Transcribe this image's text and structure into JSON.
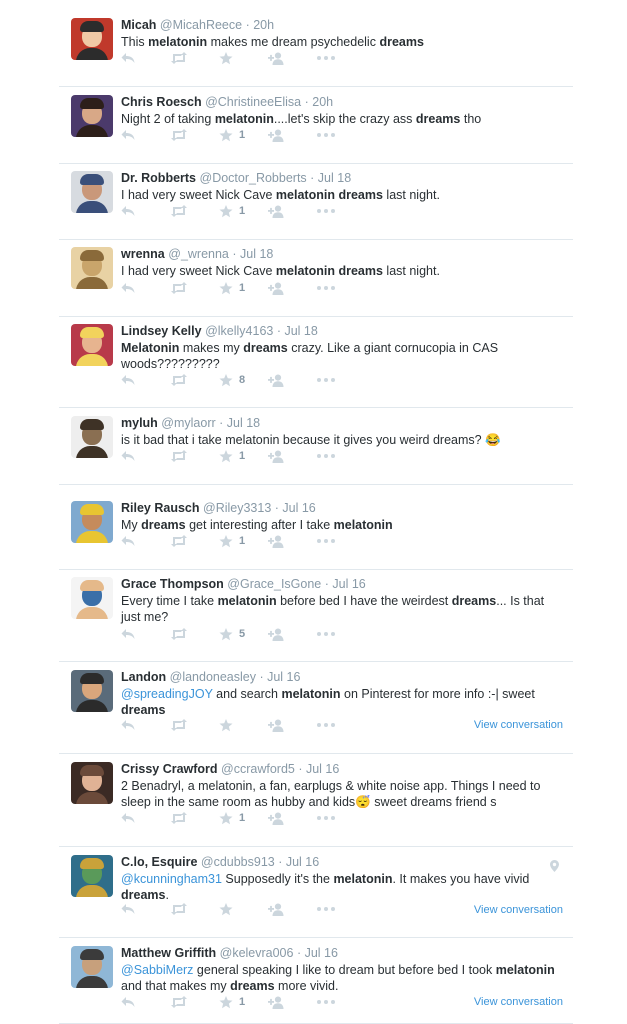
{
  "tweets": [
    {
      "name": "Micah",
      "handle": "@MicahReece",
      "time": "20h",
      "segments": [
        {
          "t": "This "
        },
        {
          "t": "melatonin",
          "b": true
        },
        {
          "t": " makes me dream psychedelic "
        },
        {
          "t": "dreams",
          "b": true
        }
      ],
      "favorites": "",
      "view_conversation": "",
      "avatar": [
        "#c0392b",
        "#f0c9a6",
        "#2c2c2c"
      ]
    },
    {
      "name": "Chris Roesch",
      "handle": "@ChristineeElisa",
      "time": "20h",
      "segments": [
        {
          "t": "Night 2 of taking "
        },
        {
          "t": "melatonin",
          "b": true
        },
        {
          "t": "....let's skip the crazy ass "
        },
        {
          "t": "dreams",
          "b": true
        },
        {
          "t": " tho"
        }
      ],
      "favorites": "1",
      "view_conversation": "",
      "avatar": [
        "#4b3a6b",
        "#d8a887",
        "#2d1f1a"
      ]
    },
    {
      "name": "Dr. Robberts",
      "handle": "@Doctor_Robberts",
      "time": "Jul 18",
      "segments": [
        {
          "t": "I had very sweet Nick Cave "
        },
        {
          "t": "melatonin",
          "b": true
        },
        {
          "t": " "
        },
        {
          "t": "dreams",
          "b": true
        },
        {
          "t": " last night."
        }
      ],
      "favorites": "1",
      "view_conversation": "",
      "avatar": [
        "#d7dbe0",
        "#c9987a",
        "#3a4f7a"
      ]
    },
    {
      "name": "wrenna",
      "handle": "@_wrenna",
      "time": "Jul 18",
      "segments": [
        {
          "t": "I had very sweet Nick Cave "
        },
        {
          "t": "melatonin",
          "b": true
        },
        {
          "t": " "
        },
        {
          "t": "dreams",
          "b": true
        },
        {
          "t": " last night."
        }
      ],
      "favorites": "1",
      "view_conversation": "",
      "avatar": [
        "#e8d2a4",
        "#c9a56b",
        "#8a6a3a"
      ]
    },
    {
      "name": "Lindsey Kelly",
      "handle": "@lkelly4163",
      "time": "Jul 18",
      "segments": [
        {
          "t": "Melatonin",
          "b": true
        },
        {
          "t": " makes my "
        },
        {
          "t": "dreams",
          "b": true
        },
        {
          "t": " crazy. Like a giant cornucopia in CAS woods?????????"
        }
      ],
      "favorites": "8",
      "view_conversation": "",
      "avatar": [
        "#b83a4a",
        "#e7b48f",
        "#f2d35c"
      ]
    },
    {
      "name": "myluh",
      "handle": "@mylaorr",
      "time": "Jul 18",
      "segments": [
        {
          "t": "is it bad that i take melatonin because it gives you weird dreams? 😂"
        }
      ],
      "favorites": "1",
      "view_conversation": "",
      "avatar": [
        "#eeeeee",
        "#8a6f52",
        "#3e3226"
      ]
    },
    {
      "name": "Riley Rausch",
      "handle": "@Riley3313",
      "time": "Jul 16",
      "segments": [
        {
          "t": "My "
        },
        {
          "t": "dreams",
          "b": true
        },
        {
          "t": " get interesting after I take "
        },
        {
          "t": "melatonin",
          "b": true
        }
      ],
      "favorites": "1",
      "view_conversation": "",
      "avatar": [
        "#7fa9cf",
        "#c58b5c",
        "#e8c531"
      ]
    },
    {
      "name": "Grace Thompson",
      "handle": "@Grace_IsGone",
      "time": "Jul 16",
      "segments": [
        {
          "t": "Every time I take "
        },
        {
          "t": "melatonin",
          "b": true
        },
        {
          "t": " before bed I have the weirdest "
        },
        {
          "t": "dreams",
          "b": true
        },
        {
          "t": "... Is that just me?"
        }
      ],
      "favorites": "5",
      "view_conversation": "",
      "avatar": [
        "#f4f4f4",
        "#3a6fa8",
        "#e5b98a"
      ]
    },
    {
      "name": "Landon",
      "handle": "@landoneasley",
      "time": "Jul 16",
      "segments": [
        {
          "t": "@spreadingJOY",
          "m": true
        },
        {
          "t": " and search "
        },
        {
          "t": "melatonin",
          "b": true
        },
        {
          "t": " on Pinterest for more info :-| sweet "
        },
        {
          "t": "dreams",
          "b": true
        }
      ],
      "favorites": "",
      "view_conversation": "View conversation",
      "avatar": [
        "#5a6b7a",
        "#d9a67c",
        "#2b2b2b"
      ]
    },
    {
      "name": "Crissy Crawford",
      "handle": "@ccrawford5",
      "time": "Jul 16",
      "segments": [
        {
          "t": "2 Benadryl, a melatonin, a fan, earplugs & white noise app. Things I need to sleep in the same room as hubby and kids😴 sweet dreams friend s"
        }
      ],
      "favorites": "1",
      "view_conversation": "",
      "avatar": [
        "#3b2a24",
        "#e0b295",
        "#6b4a3a"
      ]
    },
    {
      "name": "C.lo, Esquire",
      "handle": "@cdubbs913",
      "time": "Jul 16",
      "segments": [
        {
          "t": "@kcunningham31",
          "m": true
        },
        {
          "t": " Supposedly it's the "
        },
        {
          "t": "melatonin",
          "b": true
        },
        {
          "t": ". It makes you have vivid "
        },
        {
          "t": "dreams",
          "b": true
        },
        {
          "t": "."
        }
      ],
      "favorites": "",
      "view_conversation": "View conversation",
      "avatar": [
        "#2f6e8a",
        "#5a9a5a",
        "#c9a23a"
      ]
    },
    {
      "name": "Matthew Griffith",
      "handle": "@kelevra006",
      "time": "Jul 16",
      "segments": [
        {
          "t": "@SabbiMerz",
          "m": true
        },
        {
          "t": " general speaking I like to dream but before bed I took "
        },
        {
          "t": "melatonin",
          "b": true
        },
        {
          "t": " and that makes my "
        },
        {
          "t": "dreams",
          "b": true
        },
        {
          "t": " more vivid."
        }
      ],
      "favorites": "1",
      "view_conversation": "View conversation",
      "avatar": [
        "#8fb7d6",
        "#c7a07c",
        "#3b3b3b"
      ]
    }
  ],
  "icons": {
    "reply": "reply-icon",
    "retweet": "retweet-icon",
    "favorite": "star-icon",
    "follow": "follow-icon",
    "more": "more-icon",
    "geo": "location-pin-icon"
  },
  "colors": {
    "text": "#292f33",
    "muted": "#8899a6",
    "link": "#3b94d9",
    "divider": "#e1e8ed",
    "icon": "#ccd6dd"
  }
}
